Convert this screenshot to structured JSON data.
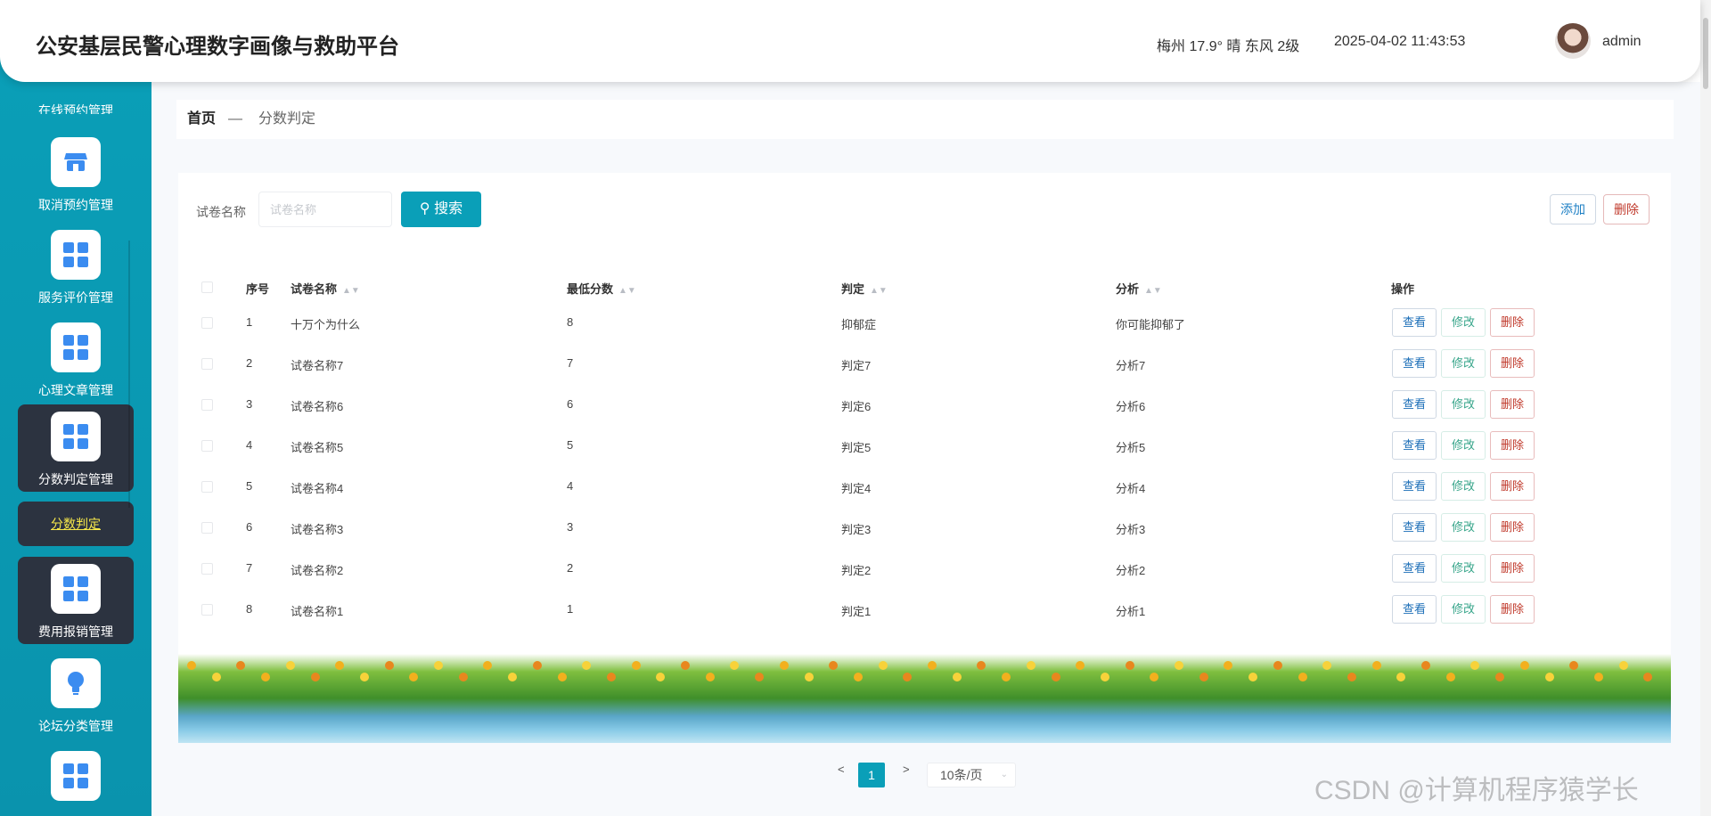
{
  "header": {
    "title": "公安基层民警心理数字画像与救助平台",
    "weather": "梅州 17.9° 晴 东风 2级",
    "datetime": "2025-04-02 11:43:53",
    "username": "admin"
  },
  "sidebar": {
    "cut_label": "在线预约管理",
    "items": [
      {
        "label": "取消预约管理",
        "icon": "store-icon"
      },
      {
        "label": "服务评价管理",
        "icon": "grid-icon"
      },
      {
        "label": "心理文章管理",
        "icon": "grid-icon"
      },
      {
        "label": "分数判定管理",
        "icon": "grid-icon"
      },
      {
        "label": "费用报销管理",
        "icon": "grid-icon"
      },
      {
        "label": "论坛分类管理",
        "icon": "bulb-icon"
      },
      {
        "label": "",
        "icon": "grid-icon"
      }
    ],
    "sub_item": "分数判定"
  },
  "breadcrumb": {
    "home": "首页",
    "separator": "—",
    "current": "分数判定"
  },
  "search": {
    "label": "试卷名称",
    "placeholder": "试卷名称",
    "button": "搜索"
  },
  "actions": {
    "add": "添加",
    "delete": "删除"
  },
  "table": {
    "headers": [
      "序号",
      "试卷名称",
      "最低分数",
      "判定",
      "分析",
      "操作"
    ],
    "rows": [
      {
        "no": "1",
        "name": "十万个为什么",
        "score": "8",
        "verdict": "抑郁症",
        "analysis": "你可能抑郁了"
      },
      {
        "no": "2",
        "name": "试卷名称7",
        "score": "7",
        "verdict": "判定7",
        "analysis": "分析7"
      },
      {
        "no": "3",
        "name": "试卷名称6",
        "score": "6",
        "verdict": "判定6",
        "analysis": "分析6"
      },
      {
        "no": "4",
        "name": "试卷名称5",
        "score": "5",
        "verdict": "判定5",
        "analysis": "分析5"
      },
      {
        "no": "5",
        "name": "试卷名称4",
        "score": "4",
        "verdict": "判定4",
        "analysis": "分析4"
      },
      {
        "no": "6",
        "name": "试卷名称3",
        "score": "3",
        "verdict": "判定3",
        "analysis": "分析3"
      },
      {
        "no": "7",
        "name": "试卷名称2",
        "score": "2",
        "verdict": "判定2",
        "analysis": "分析2"
      },
      {
        "no": "8",
        "name": "试卷名称1",
        "score": "1",
        "verdict": "判定1",
        "analysis": "分析1"
      }
    ],
    "row_actions": {
      "view": "查看",
      "edit": "修改",
      "delete": "删除"
    }
  },
  "pagination": {
    "prev": "<",
    "next": ">",
    "current_page": "1",
    "page_size": "10条/页"
  },
  "watermark": "CSDN @计算机程序猿学长",
  "colors": {
    "accent": "#0a9fb8",
    "sidebar_active": "#2c3340",
    "delete": "#c0392b"
  }
}
